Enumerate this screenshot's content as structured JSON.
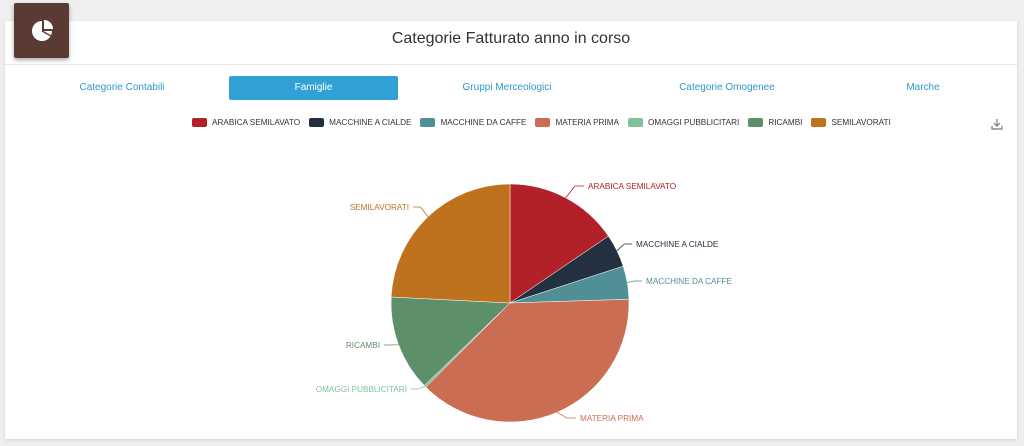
{
  "title": "Categorie Fatturato anno in corso",
  "header_icon": "pie-chart-icon",
  "download_icon": "download-icon",
  "tabs": [
    {
      "label": "Categorie Contabili",
      "active": false
    },
    {
      "label": "Famiglie",
      "active": true
    },
    {
      "label": "Gruppi Merceologici",
      "active": false
    },
    {
      "label": "Categorie Omogenee",
      "active": false
    },
    {
      "label": "Marche",
      "active": false
    }
  ],
  "colors": {
    "accent": "#31a0d4",
    "header_icon_bg": "#5a3b34"
  },
  "chart_data": {
    "type": "pie",
    "title": "",
    "legend_position": "top",
    "series": [
      {
        "categories": [
          "ARABICA SEMILAVATO",
          "MACCHINE A CIALDE",
          "MACCHINE DA CAFFE",
          "MATERIA PRIMA",
          "OMAGGI PUBBLICITARI",
          "RICAMBI",
          "SEMILAVORATI"
        ],
        "values": [
          15.5,
          4.5,
          4.5,
          38.0,
          0.3,
          13.0,
          24.2
        ],
        "colors": [
          "#b22028",
          "#22303f",
          "#4f8f95",
          "#ca6d52",
          "#7fc19b",
          "#5e8f6b",
          "#bf721e"
        ]
      }
    ]
  }
}
